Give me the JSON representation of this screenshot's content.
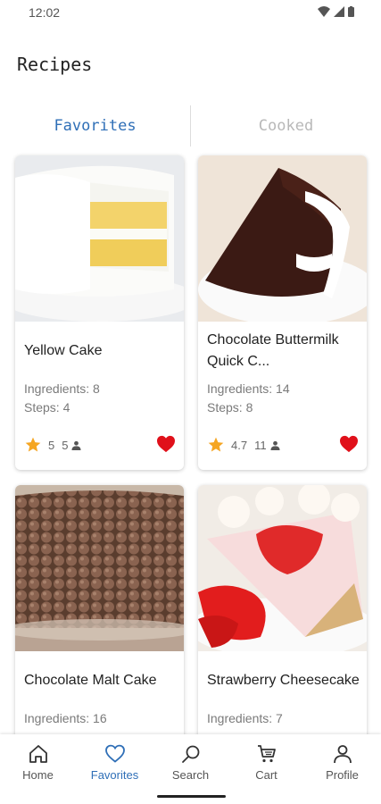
{
  "status": {
    "time": "12:02"
  },
  "page": {
    "title": "Recipes"
  },
  "tabs": [
    {
      "label": "Favorites",
      "active": true
    },
    {
      "label": "Cooked",
      "active": false
    }
  ],
  "recipes": [
    {
      "title": "Yellow Cake",
      "ingredients": "Ingredients: 8",
      "steps": "Steps: 4",
      "rating": "5",
      "votes": "5",
      "favorite": true
    },
    {
      "title": "Chocolate Buttermilk Quick C...",
      "ingredients": "Ingredients: 14",
      "steps": "Steps: 8",
      "rating": "4.7",
      "votes": "11",
      "favorite": true
    },
    {
      "title": "Chocolate Malt Cake",
      "ingredients": "Ingredients: 16",
      "steps": "",
      "rating": "",
      "votes": "",
      "favorite": true
    },
    {
      "title": "Strawberry Cheesecake",
      "ingredients": "Ingredients: 7",
      "steps": "",
      "rating": "",
      "votes": "",
      "favorite": true
    }
  ],
  "nav": [
    {
      "label": "Home",
      "icon": "home-icon",
      "active": false
    },
    {
      "label": "Favorites",
      "icon": "heart-icon",
      "active": true
    },
    {
      "label": "Search",
      "icon": "search-icon",
      "active": false
    },
    {
      "label": "Cart",
      "icon": "cart-icon",
      "active": false
    },
    {
      "label": "Profile",
      "icon": "profile-icon",
      "active": false
    }
  ],
  "colors": {
    "accent": "#2f6fb7",
    "star": "#f5a623",
    "heart": "#e0101a",
    "inactive_tab": "#b8b8b8"
  }
}
